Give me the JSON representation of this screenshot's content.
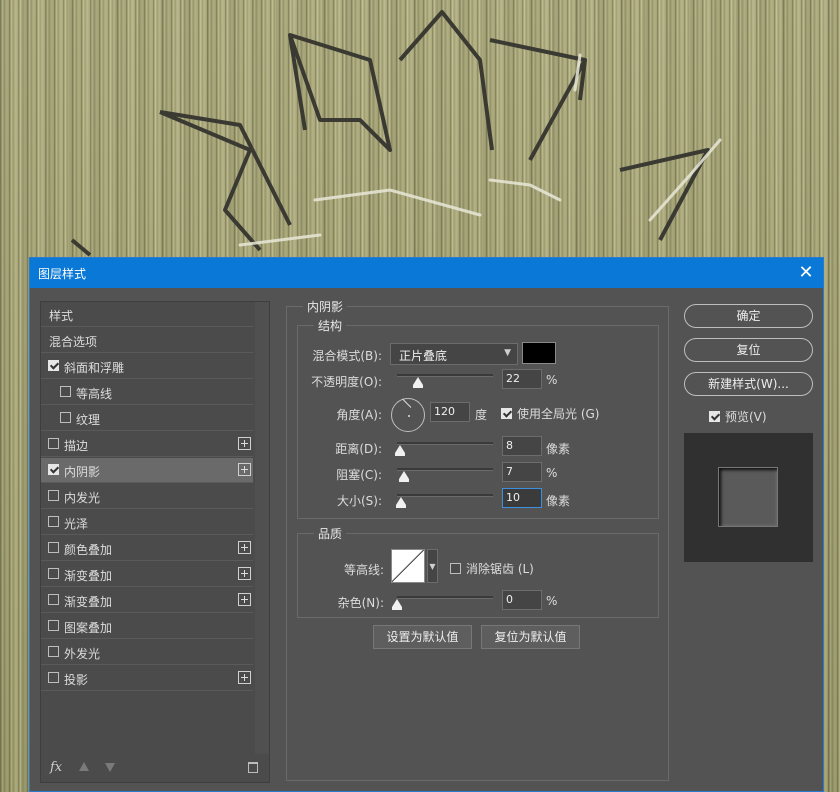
{
  "dialog": {
    "title": "图层样式",
    "close_glyph": "✕"
  },
  "style_list": {
    "items": [
      {
        "label": "样式",
        "checkbox": false,
        "checked": false,
        "plus": false,
        "indent": false
      },
      {
        "label": "混合选项",
        "checkbox": false,
        "checked": false,
        "plus": false,
        "indent": false
      },
      {
        "label": "斜面和浮雕",
        "checkbox": true,
        "checked": true,
        "plus": false,
        "indent": false
      },
      {
        "label": "等高线",
        "checkbox": true,
        "checked": false,
        "plus": false,
        "indent": true
      },
      {
        "label": "纹理",
        "checkbox": true,
        "checked": false,
        "plus": false,
        "indent": true
      },
      {
        "label": "描边",
        "checkbox": true,
        "checked": false,
        "plus": true,
        "indent": false
      },
      {
        "label": "内阴影",
        "checkbox": true,
        "checked": true,
        "plus": true,
        "indent": false,
        "selected": true
      },
      {
        "label": "内发光",
        "checkbox": true,
        "checked": false,
        "plus": false,
        "indent": false
      },
      {
        "label": "光泽",
        "checkbox": true,
        "checked": false,
        "plus": false,
        "indent": false
      },
      {
        "label": "颜色叠加",
        "checkbox": true,
        "checked": false,
        "plus": true,
        "indent": false
      },
      {
        "label": "渐变叠加",
        "checkbox": true,
        "checked": false,
        "plus": true,
        "indent": false
      },
      {
        "label": "渐变叠加",
        "checkbox": true,
        "checked": false,
        "plus": true,
        "indent": false
      },
      {
        "label": "图案叠加",
        "checkbox": true,
        "checked": false,
        "plus": false,
        "indent": false
      },
      {
        "label": "外发光",
        "checkbox": true,
        "checked": false,
        "plus": false,
        "indent": false
      },
      {
        "label": "投影",
        "checkbox": true,
        "checked": false,
        "plus": true,
        "indent": false
      }
    ],
    "footer": {
      "fx_label": "fx"
    }
  },
  "inner_shadow": {
    "group_title": "内阴影",
    "structure": {
      "title": "结构",
      "blend_mode_label": "混合模式(B):",
      "blend_mode_value": "正片叠底",
      "shadow_color": "#000000",
      "opacity_label": "不透明度(O):",
      "opacity_value": "22",
      "opacity_pct": 22,
      "opacity_unit": "%",
      "angle_label": "角度(A):",
      "angle_value": "120",
      "angle_unit": "度",
      "global_light_label": "使用全局光 (G)",
      "global_light_checked": true,
      "distance_label": "距离(D):",
      "distance_value": "8",
      "distance_unit": "像素",
      "choke_label": "阻塞(C):",
      "choke_value": "7",
      "choke_unit": "%",
      "size_label": "大小(S):",
      "size_value": "10",
      "size_unit": "像素"
    },
    "quality": {
      "title": "品质",
      "contour_label": "等高线:",
      "antialias_label": "消除锯齿 (L)",
      "antialias_checked": false,
      "noise_label": "杂色(N):",
      "noise_value": "0",
      "noise_unit": "%"
    },
    "buttons": {
      "make_default": "设置为默认值",
      "reset_default": "复位为默认值"
    }
  },
  "right_panel": {
    "ok": "确定",
    "reset": "复位",
    "new_style": "新建样式(W)...",
    "preview_label": "预览(V)",
    "preview_checked": true
  },
  "colors": {
    "titlebar": "#0a78d7",
    "dialog_bg": "#535353"
  }
}
